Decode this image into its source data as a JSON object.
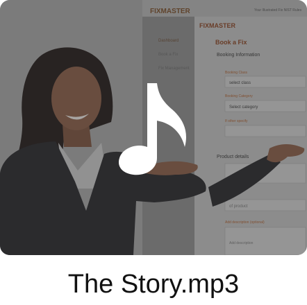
{
  "file": {
    "name": "The Story.mp3",
    "type_icon": "music-note-icon"
  },
  "thumbnail": {
    "brand": "FIXMASTER",
    "top_bar_text": "Your Illustrated Fix NIST Rules",
    "sidebar_items": [
      "Dashboard",
      "Book a Fix",
      "Fix Management"
    ],
    "page_title": "Book a Fix",
    "section_booking": "Booking Information",
    "booking_class_label": "Booking Class",
    "booking_class_value": "select class",
    "booking_category_label": "Booking Category",
    "booking_category_value": "Select category",
    "other_specify_label": "If other specify",
    "product_details_label": "Product details",
    "product_field_placeholder": "of product",
    "description_label": "Add description (optional)",
    "description_placeholder": "Add description"
  },
  "colors": {
    "overlay": "#5a5a5a",
    "accent_orange": "#d9772a",
    "jacket": "#1f1f24",
    "text": "#111111"
  }
}
